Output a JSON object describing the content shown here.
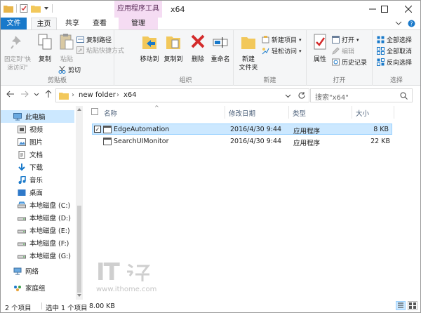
{
  "titlebar": {
    "tool_tab": "应用程序工具",
    "title": "x64"
  },
  "tabs": {
    "file": "文件",
    "home": "主页",
    "share": "共享",
    "view": "查看",
    "manage": "管理"
  },
  "ribbon": {
    "pin": "固定到\"快\n速访问\"",
    "copy": "复制",
    "paste": "粘贴",
    "copy_path": "复制路径",
    "paste_shortcut": "粘贴快捷方式",
    "cut": "剪切",
    "clipboard_label": "剪贴板",
    "move_to": "移动到",
    "copy_to": "复制到",
    "delete": "删除",
    "rename": "重命名",
    "organize_label": "组织",
    "new_folder": "新建\n文件夹",
    "new_item": "新建项目",
    "easy_access": "轻松访问",
    "new_label": "新建",
    "properties": "属性",
    "open": "打开",
    "edit": "编辑",
    "history": "历史记录",
    "open_label": "打开",
    "select_all": "全部选择",
    "select_none": "全部取消",
    "invert_selection": "反向选择",
    "select_label": "选择"
  },
  "address": {
    "breadcrumb_1": "new folder",
    "breadcrumb_2": "x64",
    "search_placeholder": "搜索\"x64\""
  },
  "nav": {
    "items": [
      {
        "label": "此电脑"
      },
      {
        "label": "视频"
      },
      {
        "label": "图片"
      },
      {
        "label": "文档"
      },
      {
        "label": "下载"
      },
      {
        "label": "音乐"
      },
      {
        "label": "桌面"
      },
      {
        "label": "本地磁盘 (C:)"
      },
      {
        "label": "本地磁盘 (D:)"
      },
      {
        "label": "本地磁盘 (E:)"
      },
      {
        "label": "本地磁盘 (F:)"
      },
      {
        "label": "本地磁盘 (G:)"
      },
      {
        "label": "网络"
      },
      {
        "label": "家庭组"
      }
    ]
  },
  "columns": {
    "name": "名称",
    "modified": "修改日期",
    "type": "类型",
    "size": "大小"
  },
  "files": [
    {
      "name": "EdgeAutomation",
      "modified": "2016/4/30 9:44",
      "type": "应用程序",
      "size": "8 KB"
    },
    {
      "name": "SearchUIMonitor",
      "modified": "2016/4/30 9:44",
      "type": "应用程序",
      "size": "22 KB"
    }
  ],
  "status": {
    "item_count": "2 个项目",
    "selection": "选中 1 个项目",
    "sel_size": "8.00 KB"
  },
  "watermark": {
    "logo": "IT",
    "url": "www.ithome.com"
  },
  "colors": {
    "accent": "#1979ca",
    "tool_tab": "#f5dcf3",
    "selection": "#cce8ff"
  }
}
